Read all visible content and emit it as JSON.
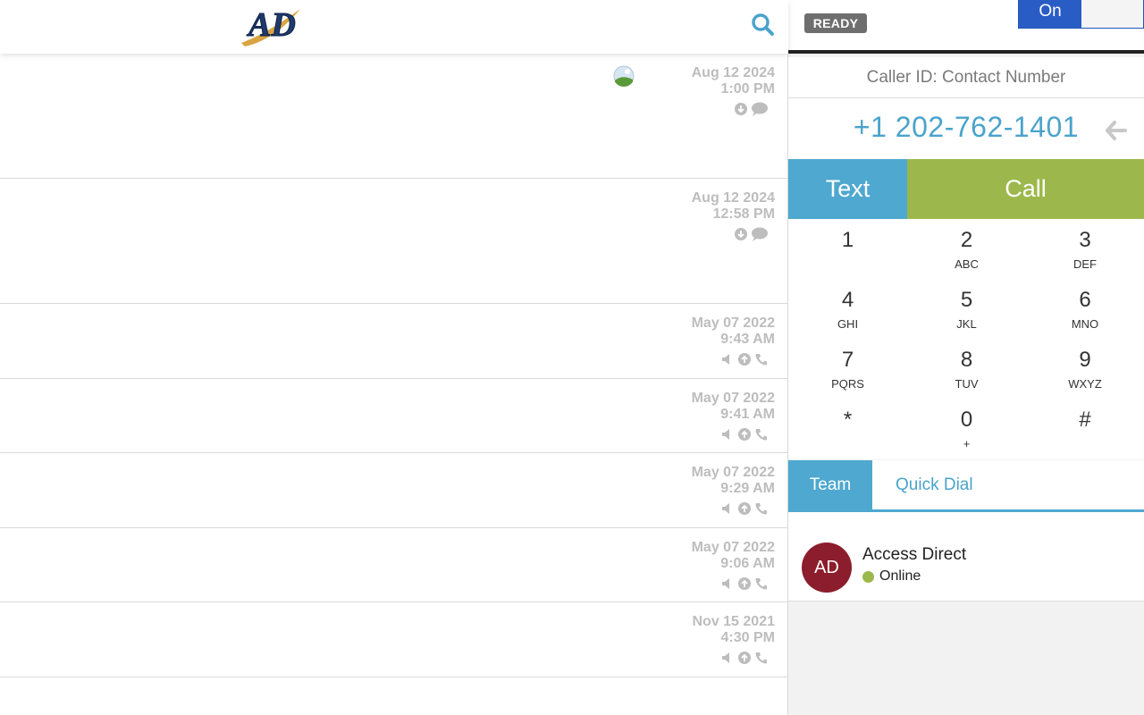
{
  "app": {
    "logo_text": "AD",
    "search_icon": "search-icon"
  },
  "conversations": [
    {
      "date": "Aug 12 2024",
      "time": "1:00 PM",
      "type": "message",
      "icons": [
        "download-icon",
        "chat-bubble-icon"
      ],
      "has_thumb": true
    },
    {
      "date": "Aug 12 2024",
      "time": "12:58 PM",
      "type": "message",
      "icons": [
        "download-icon",
        "chat-bubble-icon"
      ],
      "has_thumb": false
    },
    {
      "date": "May 07 2022",
      "time": "9:43 AM",
      "type": "call",
      "icons": [
        "speaker-icon",
        "upload-icon",
        "phone-icon"
      ]
    },
    {
      "date": "May 07 2022",
      "time": "9:41 AM",
      "type": "call",
      "icons": [
        "speaker-icon",
        "upload-icon",
        "phone-icon"
      ]
    },
    {
      "date": "May 07 2022",
      "time": "9:29 AM",
      "type": "call",
      "icons": [
        "speaker-icon",
        "upload-icon",
        "phone-icon"
      ]
    },
    {
      "date": "May 07 2022",
      "time": "9:06 AM",
      "type": "call",
      "icons": [
        "speaker-icon",
        "upload-icon",
        "phone-icon"
      ]
    },
    {
      "date": "Nov 15 2021",
      "time": "4:30 PM",
      "type": "call",
      "icons": [
        "speaker-icon",
        "upload-icon",
        "phone-icon"
      ]
    }
  ],
  "status": {
    "badge": "READY",
    "toggle_on_label": "On"
  },
  "dialer": {
    "caller_id": "Caller ID: Contact Number",
    "phone_number": "+1 202-762-1401",
    "text_label": "Text",
    "call_label": "Call",
    "keys": [
      {
        "digit": "1",
        "letters": ""
      },
      {
        "digit": "2",
        "letters": "ABC"
      },
      {
        "digit": "3",
        "letters": "DEF"
      },
      {
        "digit": "4",
        "letters": "GHI"
      },
      {
        "digit": "5",
        "letters": "JKL"
      },
      {
        "digit": "6",
        "letters": "MNO"
      },
      {
        "digit": "7",
        "letters": "PQRS"
      },
      {
        "digit": "8",
        "letters": "TUV"
      },
      {
        "digit": "9",
        "letters": "WXYZ"
      },
      {
        "digit": "*",
        "letters": ""
      },
      {
        "digit": "0",
        "letters": "+"
      },
      {
        "digit": "#",
        "letters": ""
      }
    ]
  },
  "tabs": {
    "team": "Team",
    "quick_dial": "Quick Dial"
  },
  "team": [
    {
      "initials": "AD",
      "name": "Access Direct",
      "status": "Online"
    }
  ],
  "colors": {
    "accent_blue": "#4ea8cf",
    "call_green": "#9cb84c",
    "avatar_red": "#8c1d2c",
    "toggle_blue": "#2a5cc6"
  }
}
